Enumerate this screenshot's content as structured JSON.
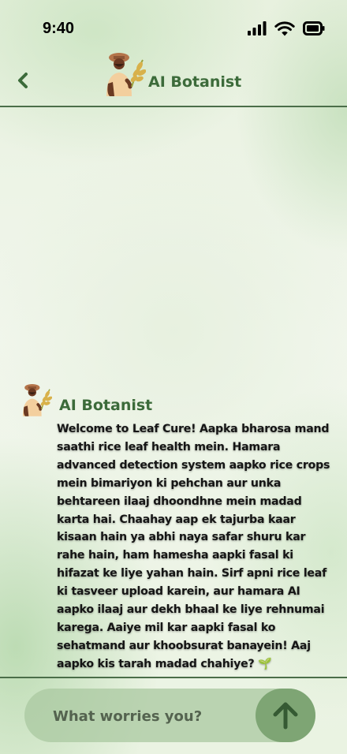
{
  "status_bar": {
    "time": "9:40",
    "icons": [
      "cellular-signal-icon",
      "wifi-icon",
      "battery-icon"
    ]
  },
  "header": {
    "back_icon": "chevron-left-icon",
    "avatar_icon": "farmer-avatar-icon",
    "title": "AI Botanist"
  },
  "messages": [
    {
      "sender": "AI Botanist",
      "avatar_icon": "farmer-avatar-icon",
      "text": "Welcome to Leaf Cure! Aapka bharosa mand saathi rice leaf health mein. Hamara advanced detection system aapko rice crops mein bimariyon ki pehchan aur unka behtareen ilaaj dhoondhne mein madad karta hai. Chaahay aap ek tajurba kaar kisaan hain ya abhi naya safar shuru kar rahe hain, ham hamesha aapki fasal ki hifazat ke liye yahan hain. Sirf apni rice leaf ki tasveer upload karein, aur hamara AI aapko ilaaj aur dekh bhaal ke liye rehnumai karega. Aaiye mil kar aapki fasal ko sehatmand aur khoobsurat banayein! Aaj aapko kis tarah madad chahiye? 🌱"
    }
  ],
  "composer": {
    "placeholder": "What worries you?",
    "send_icon": "arrow-up-icon"
  },
  "colors": {
    "accent": "#3c6b3a",
    "divider": "#4b6e49",
    "input_bg": "#aac8a0",
    "send_bg": "#7ea574"
  }
}
